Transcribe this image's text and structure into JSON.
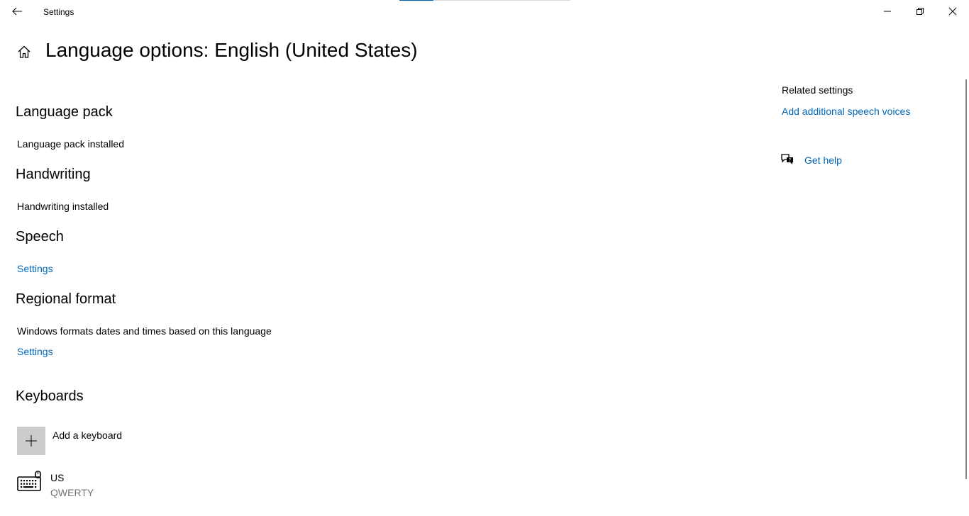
{
  "titlebar": {
    "app_title": "Settings",
    "progress_fraction": 0.2
  },
  "header": {
    "title": "Language options: English (United States)"
  },
  "sections": {
    "language_pack": {
      "title": "Language pack",
      "status": "Language pack installed"
    },
    "handwriting": {
      "title": "Handwriting",
      "status": "Handwriting installed"
    },
    "speech": {
      "title": "Speech",
      "settings_link": "Settings"
    },
    "regional_format": {
      "title": "Regional format",
      "description": "Windows formats dates and times based on this language",
      "settings_link": "Settings"
    },
    "keyboards": {
      "title": "Keyboards",
      "add_label": "Add a keyboard",
      "items": [
        {
          "name": "US",
          "layout": "QWERTY"
        }
      ]
    }
  },
  "related": {
    "title": "Related settings",
    "speech_voices_link": "Add additional speech voices",
    "get_help_link": "Get help"
  },
  "colors": {
    "link": "#0067b8",
    "accent": "#0063b1",
    "add_box": "#cccccc",
    "secondary_text": "#737373"
  },
  "icons": {
    "back": "back-arrow-icon",
    "home": "home-icon",
    "minimize": "minimize-icon",
    "maximize": "restore-icon",
    "close": "close-icon",
    "add": "plus-icon",
    "keyboard": "keyboard-icon",
    "help": "chat-help-icon"
  }
}
